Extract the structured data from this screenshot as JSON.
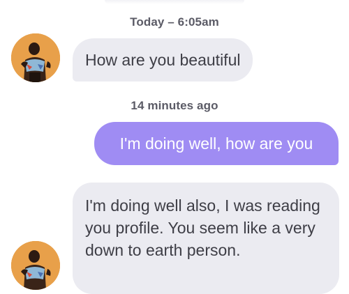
{
  "conversation": {
    "timestamps": [
      "Today – 6:05am",
      "14 minutes ago"
    ],
    "messages": [
      {
        "direction": "incoming",
        "text": "How are you beautiful"
      },
      {
        "direction": "outgoing",
        "text": "I'm doing well, how are you"
      },
      {
        "direction": "incoming",
        "text": "I'm doing well also, I was reading you profile. You seem like a very down to earth person."
      }
    ]
  },
  "colors": {
    "incoming_bubble": "#ebebf1",
    "outgoing_bubble": "#9f8cf3",
    "timestamp_text": "#5b5b66",
    "avatar_background": "#e59a3c"
  },
  "icons": {
    "avatar": "user-avatar-photo"
  }
}
